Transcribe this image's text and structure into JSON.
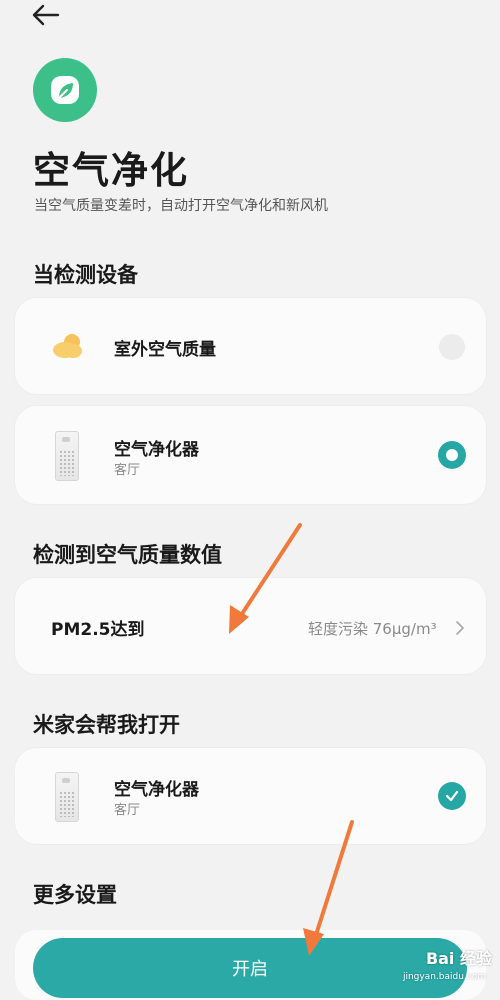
{
  "page": {
    "title": "空气净化",
    "subtitle": "当空气质量变差时，自动打开空气净化和新风机"
  },
  "sections": {
    "detect_device": "当检测设备",
    "detect_value": "检测到空气质量数值",
    "mijia_open": "米家会帮我打开",
    "more_settings": "更多设置"
  },
  "detect_devices": [
    {
      "label": "室外空气质量",
      "selected": false,
      "icon": "cloud-sun-icon"
    },
    {
      "label": "空气净化器",
      "room": "客厅",
      "selected": true,
      "icon": "air-purifier-icon"
    }
  ],
  "threshold": {
    "label": "PM2.5达到",
    "value": "轻度污染 76μg/m³"
  },
  "open_device": {
    "label": "空气净化器",
    "room": "客厅",
    "checked": true,
    "icon": "air-purifier-icon"
  },
  "start_button": "开启",
  "watermark": {
    "brand": "Bai 经验",
    "url": "jingyan.baidu.com"
  },
  "colors": {
    "accent": "#27a7a4",
    "app_icon": "#3dbf8a",
    "annotation_arrow": "#f07a3c"
  }
}
